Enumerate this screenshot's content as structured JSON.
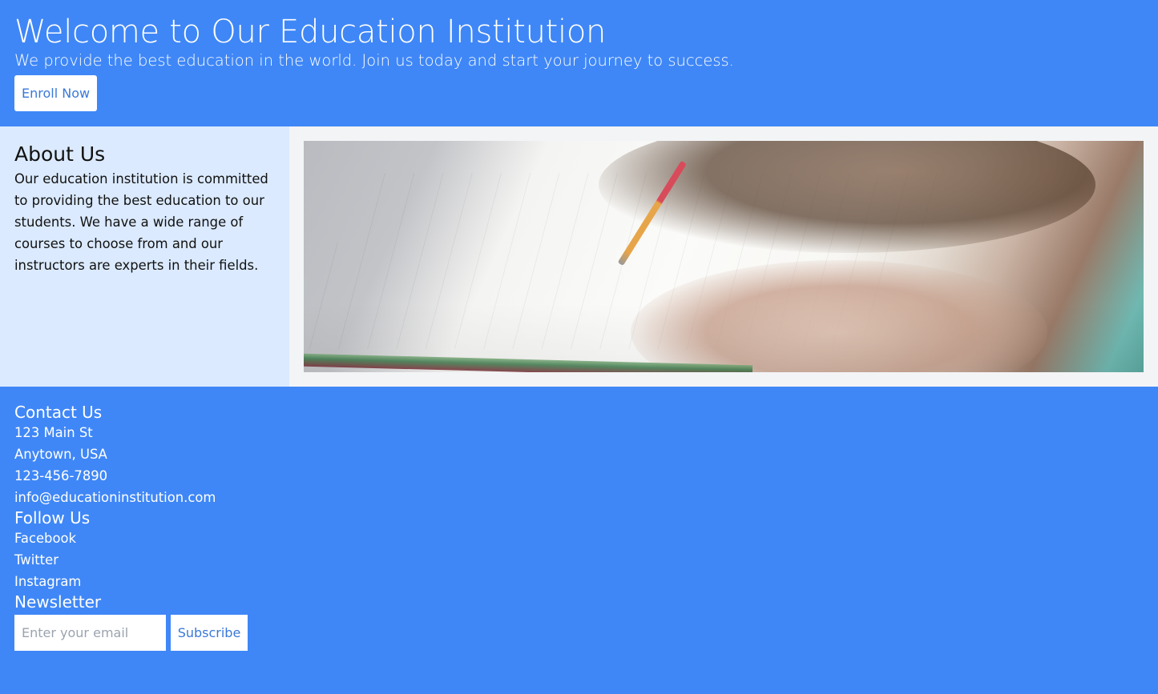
{
  "header": {
    "title": "Welcome to Our Education Institution",
    "tagline": "We provide the best education in the world. Join us today and start your journey to success.",
    "enroll_label": "Enroll Now"
  },
  "about": {
    "heading": "About Us",
    "body": "Our education institution is committed to providing the best education to our students. We have a wide range of courses to choose from and our instructors are experts in their fields."
  },
  "media": {
    "image_description": "hand writing with a pencil in a notebook"
  },
  "footer": {
    "contact": {
      "heading": "Contact Us",
      "lines": [
        "123 Main St",
        "Anytown, USA",
        "123-456-7890",
        "info@educationinstitution.com"
      ]
    },
    "follow": {
      "heading": "Follow Us",
      "links": [
        "Facebook",
        "Twitter",
        "Instagram"
      ]
    },
    "newsletter": {
      "heading": "Newsletter",
      "email_placeholder": "Enter your email",
      "email_value": "",
      "subscribe_label": "Subscribe"
    }
  },
  "colors": {
    "brand_blue": "#3f87f7",
    "about_bg": "#dbeafe",
    "media_bg": "#f3f4f6",
    "button_text": "#3a78d8"
  }
}
